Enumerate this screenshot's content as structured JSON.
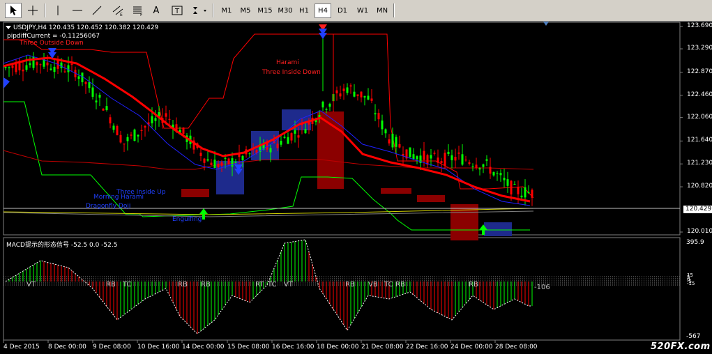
{
  "toolbar": {
    "tools": [
      {
        "name": "cursor-tool",
        "glyph": "cursor"
      },
      {
        "name": "crosshair-tool",
        "glyph": "crosshair"
      },
      {
        "name": "vertical-line-tool",
        "glyph": "vline"
      },
      {
        "name": "horizontal-line-tool",
        "glyph": "hline"
      },
      {
        "name": "trendline-tool",
        "glyph": "trend"
      },
      {
        "name": "equidistant-channel-tool",
        "glyph": "channel"
      },
      {
        "name": "fibonacci-tool",
        "glyph": "fibo"
      },
      {
        "name": "text-tool",
        "label": "A"
      },
      {
        "name": "text-label-tool",
        "label": "T"
      },
      {
        "name": "arrows-tool",
        "glyph": "arrows"
      }
    ],
    "timeframes": [
      "M1",
      "M5",
      "M15",
      "M30",
      "H1",
      "H4",
      "D1",
      "W1",
      "MN"
    ],
    "active_timeframe": "H4"
  },
  "main_chart": {
    "header": "USDJPY,H4  120.435 120.452 120.382 120.429",
    "indicator_line": "pipdiffCurrent = -0.11256067",
    "price_labels": [
      "123.690",
      "123.290",
      "122.870",
      "122.460",
      "122.060",
      "121.640",
      "121.230",
      "120.820",
      "120.010"
    ],
    "current_price": "120.429",
    "pattern_labels": [
      {
        "text": "Three Outside Down",
        "color": "#ff2020"
      },
      {
        "text": "Harami",
        "color": "#ff2020"
      },
      {
        "text": "Three Inside Down",
        "color": "#ff2020"
      },
      {
        "text": "Three Inside Up",
        "color": "#2040ff"
      },
      {
        "text": "Morning Harami",
        "color": "#2040ff"
      },
      {
        "text": "Dragonfly Doji",
        "color": "#2040ff"
      },
      {
        "text": "Engulfing",
        "color": "#2040ff"
      }
    ]
  },
  "sub_chart": {
    "header": "MACD提示的形态信号 -52.5 0.0 -52.5",
    "scale_labels": [
      "395.9",
      "-567"
    ],
    "zero_labels": [
      "15",
      "5",
      "0",
      "-5",
      "-15"
    ],
    "signal_labels": [
      "VT",
      "RB",
      "TC",
      "RB",
      "RB",
      "RT",
      "TC",
      "VT",
      "RB",
      "VB",
      "TC",
      "RB",
      "RB"
    ],
    "last_value": "-106"
  },
  "time_axis": [
    "4 Dec 2015",
    "8 Dec 00:00",
    "9 Dec 08:00",
    "10 Dec 16:00",
    "14 Dec 00:00",
    "15 Dec 08:00",
    "16 Dec 16:00",
    "18 Dec 00:00",
    "21 Dec 08:00",
    "22 Dec 16:00",
    "24 Dec 00:00",
    "28 Dec 08:00"
  ],
  "watermark": "520FX.com",
  "colors": {
    "bull_candle": "#00ff00",
    "bear_candle": "#ff0000",
    "red_ma": "#ff0000",
    "blue_ma": "#2020ff",
    "channel_upper": "#ff0000",
    "channel_lower": "#00ff00",
    "highlight_bull": "#1e2a8c",
    "highlight_bear": "#8b0000"
  },
  "chart_data": {
    "type": "candlestick",
    "title": "USDJPY,H4",
    "ylim": [
      120.0,
      123.7
    ],
    "x": [
      "4 Dec 2015",
      "8 Dec 00:00",
      "9 Dec 08:00",
      "10 Dec 16:00",
      "14 Dec 00:00",
      "15 Dec 08:00",
      "16 Dec 16:00",
      "18 Dec 00:00",
      "21 Dec 08:00",
      "22 Dec 16:00",
      "24 Dec 00:00",
      "28 Dec 08:00"
    ],
    "last_close": 120.429,
    "series": [
      {
        "name": "USDJPY",
        "type": "candles"
      }
    ]
  }
}
